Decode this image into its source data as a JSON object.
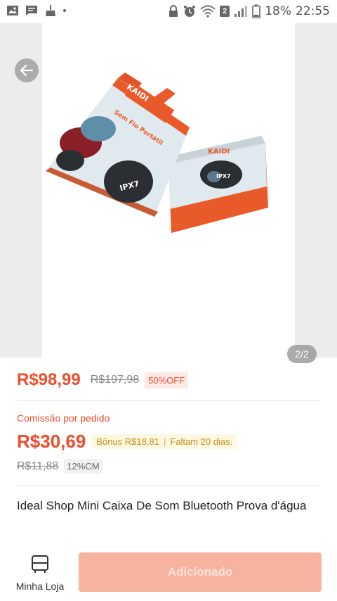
{
  "status_bar": {
    "battery": "18%",
    "time": "22:55",
    "sim_badge": "2"
  },
  "gallery": {
    "page_indicator": "2/2",
    "box_brand": "KAIDI",
    "box_text": "Sem Fio Portátil",
    "box_badge": "IPX7"
  },
  "price": {
    "current": "R$98,99",
    "original": "R$197,98",
    "discount": "50%OFF"
  },
  "commission": {
    "label": "Comissão por pedido",
    "value": "R$30,69",
    "bonus": "Bônus R$18,81",
    "remaining": "Faltam 20 dias.",
    "old_value": "R$11,88",
    "rate": "12%CM"
  },
  "product": {
    "title": "Ideal Shop Mini Caixa De Som Bluetooth Prova d'água"
  },
  "bottom_bar": {
    "store_label": "Minha Loja",
    "action_label": "Adicionado"
  },
  "colors": {
    "accent": "#ee4d2d",
    "disabled_button": "#f8b2a0",
    "bonus_bg": "#fff8e1"
  }
}
